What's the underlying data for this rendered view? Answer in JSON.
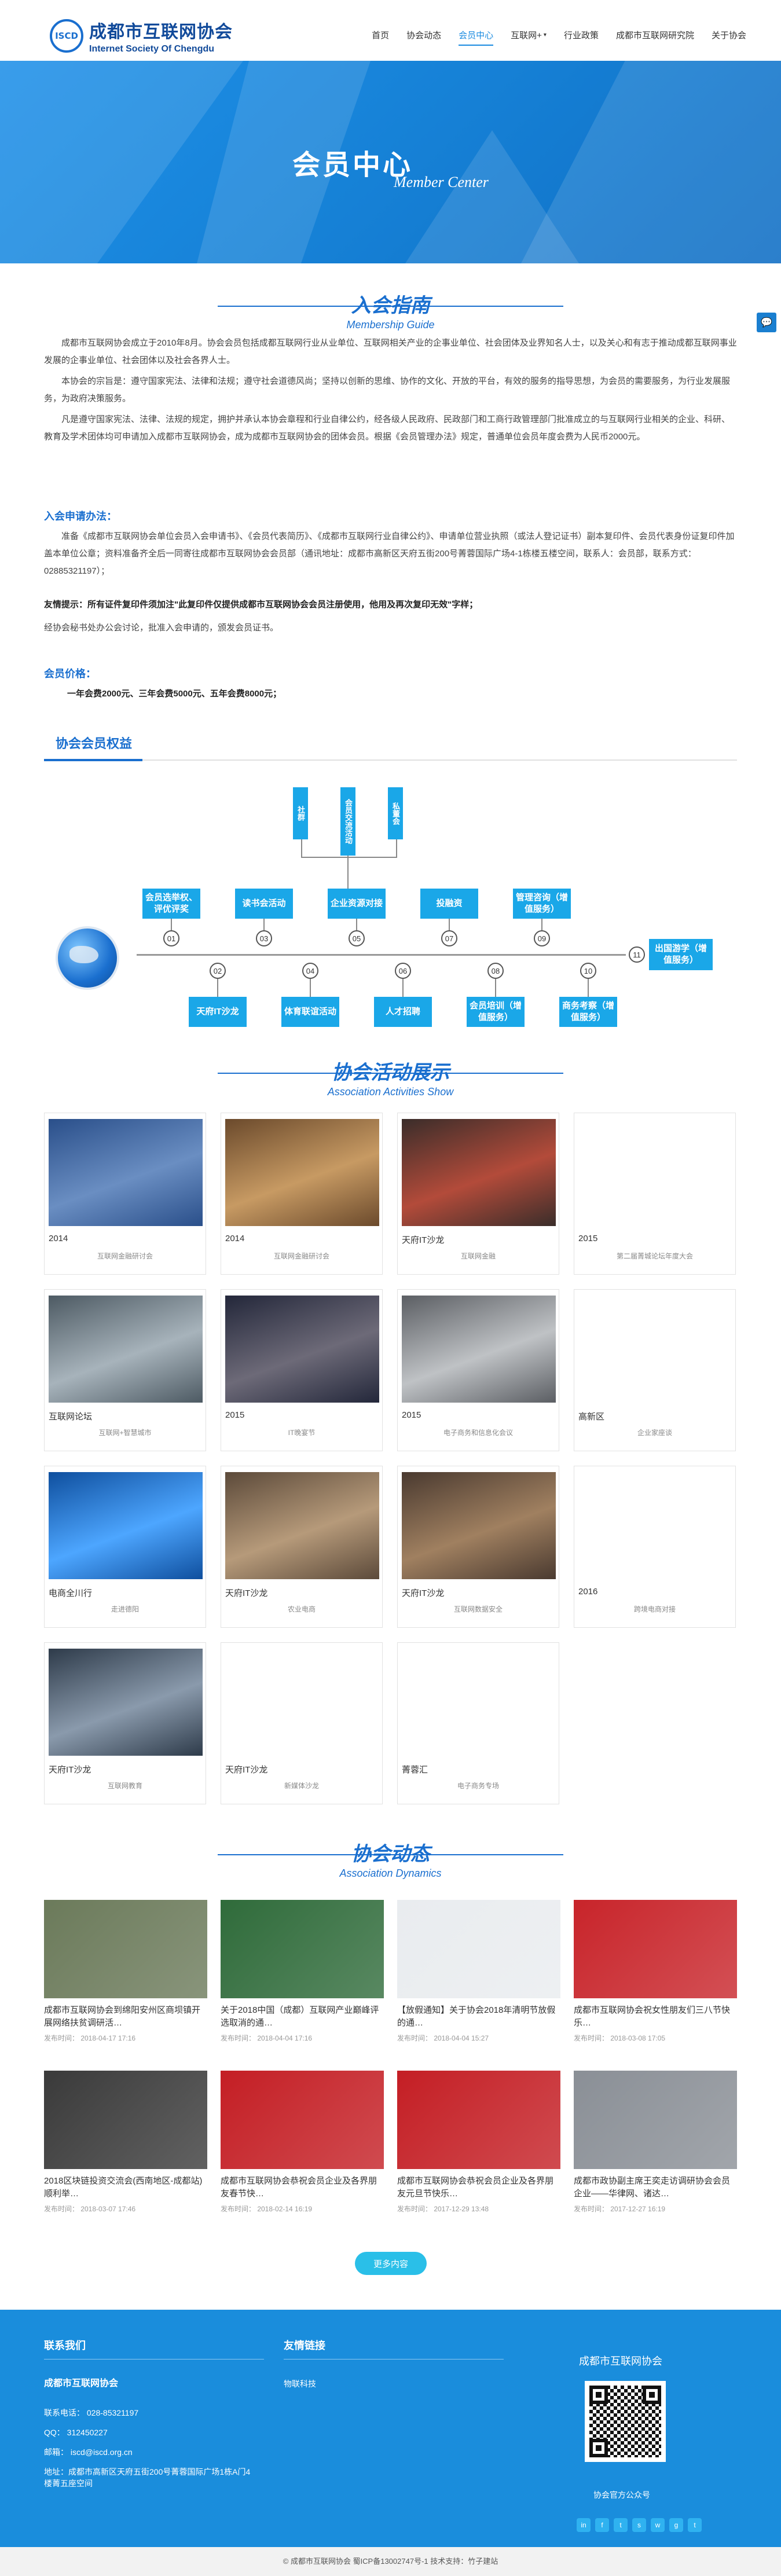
{
  "header": {
    "logo_badge": "ISCD",
    "logo_cn": "成都市互联网协会",
    "logo_en": "Internet Society Of Chengdu",
    "nav": [
      {
        "label": "首页",
        "active": false,
        "arrow": false
      },
      {
        "label": "协会动态",
        "active": false,
        "arrow": false
      },
      {
        "label": "会员中心",
        "active": true,
        "arrow": false
      },
      {
        "label": "互联网+",
        "active": false,
        "arrow": true
      },
      {
        "label": "行业政策",
        "active": false,
        "arrow": false
      },
      {
        "label": "成都市互联网研究院",
        "active": false,
        "arrow": false
      },
      {
        "label": "关于协会",
        "active": false,
        "arrow": false
      }
    ]
  },
  "banner": {
    "title": "会员中心",
    "subtitle": "Member Center"
  },
  "guide": {
    "title": "入会指南",
    "subtitle": "Membership Guide",
    "p1": "成都市互联网协会成立于2010年8月。协会会员包括成都互联网行业从业单位、互联网相关产业的企事业单位、社会团体及业界知名人士，以及关心和有志于推动成都互联网事业发展的企事业单位、社会团体以及社会各界人士。",
    "p2": "本协会的宗旨是：遵守国家宪法、法律和法规；遵守社会道德风尚；坚持以创新的思维、协作的文化、开放的平台，有效的服务的指导思想，为会员的需要服务，为行业发展服务，为政府决策服务。",
    "p3": "凡是遵守国家宪法、法律、法规的规定，拥护并承认本协会章程和行业自律公约，经各级人民政府、民政部门和工商行政管理部门批准成立的与互联网行业相关的企业、科研、教育及学术团体均可申请加入成都市互联网协会，成为成都市互联网协会的团体会员。根据《会员管理办法》规定，普通单位会员年度会费为人民币2000元。",
    "apply_title": "入会申请办法：",
    "apply_p": "准备《成都市互联网协会单位会员入会申请书》、《会员代表简历》、《成都市互联网行业自律公约》、申请单位营业执照（或法人登记证书）副本复印件、会员代表身份证复印件加盖本单位公章；资料准备齐全后一同寄往成都市互联网协会会员部（通讯地址：成都市高新区天府五街200号菁蓉国际广场4-1栋楼五楼空间，联系人：会员部，联系方式：02885321197）；",
    "warm_tip": "友情提示：所有证件复印件须加注\"此复印件仅提供成都市互联网协会会员注册使用，他用及再次复印无效\"字样；",
    "review": "经协会秘书处办公会讨论，批准入会申请的，颁发会员证书。",
    "fee_title": "会员价格：",
    "fee_text": "一年会费2000元、三年会费5000元、五年会费8000元；"
  },
  "structure": {
    "title": "协会会员权益",
    "vertical_boxes": [
      "社群",
      "会员交流活动",
      "私董会"
    ],
    "top_boxes": [
      "会员选举权、评优评奖",
      "读书会活动",
      "企业资源对接",
      "投融资",
      "管理咨询（增值服务）"
    ],
    "bottom_boxes": [
      "天府IT沙龙",
      "体育联谊活动",
      "人才招聘",
      "会员培训（增值服务）",
      "商务考察（增值服务）"
    ],
    "end_box": "出国游学（增值服务）",
    "nodes": [
      "01",
      "02",
      "03",
      "04",
      "05",
      "06",
      "07",
      "08",
      "09",
      "10",
      "11"
    ]
  },
  "activities": {
    "title": "协会活动展示",
    "subtitle": "Association Activities Show",
    "cards": [
      {
        "caption": "2014",
        "sub": "互联网金融研讨会"
      },
      {
        "caption": "2014",
        "sub": "互联网金融研讨会"
      },
      {
        "caption": "天府IT沙龙",
        "sub": "互联网金融"
      },
      {
        "caption": "2015",
        "sub": "第二届菁城论坛年度大会"
      },
      {
        "caption": "互联网论坛",
        "sub": "互联网+智慧城市"
      },
      {
        "caption": "2015",
        "sub": "IT晚宴节"
      },
      {
        "caption": "2015",
        "sub": "电子商务和信息化会议"
      },
      {
        "caption": "高新区",
        "sub": "企业家座谈"
      },
      {
        "caption": "电商全川行",
        "sub": "走进德阳"
      },
      {
        "caption": "天府IT沙龙",
        "sub": "农业电商"
      },
      {
        "caption": "天府IT沙龙",
        "sub": "互联网数据安全"
      },
      {
        "caption": "2016",
        "sub": "跨境电商对接"
      },
      {
        "caption": "天府IT沙龙",
        "sub": "互联网教育"
      },
      {
        "caption": "天府IT沙龙",
        "sub": "新媒体沙龙"
      },
      {
        "caption": "菁蓉汇",
        "sub": "电子商务专场"
      }
    ]
  },
  "news": {
    "title": "协会动态",
    "subtitle": "Association Dynamics",
    "items": [
      {
        "title": "成都市互联网协会到绵阳安州区商坝镇开展网络扶贫调研活…",
        "date": "发布时间： 2018-04-17 17:16"
      },
      {
        "title": "关于2018中国（成都）互联网产业巅峰评选取消的通…",
        "date": "发布时间： 2018-04-04 17:16"
      },
      {
        "title": "【放假通知】关于协会2018年清明节放假的通…",
        "date": "发布时间： 2018-04-04 15:27"
      },
      {
        "title": "成都市互联网协会祝女性朋友们三八节快乐…",
        "date": "发布时间： 2018-03-08 17:05"
      },
      {
        "title": "2018区块链投资交流会(西南地区-成都站)顺利举…",
        "date": "发布时间： 2018-03-07 17:46"
      },
      {
        "title": "成都市互联网协会恭祝会员企业及各界朋友春节快…",
        "date": "发布时间： 2018-02-14 16:19"
      },
      {
        "title": "成都市互联网协会恭祝会员企业及各界朋友元旦节快乐…",
        "date": "发布时间： 2017-12-29 13:48"
      },
      {
        "title": "成都市政协副主席王奕走访调研协会会员企业——华律网、诸达…",
        "date": "发布时间： 2017-12-27 16:19"
      }
    ],
    "more": "更多内容"
  },
  "footer": {
    "contact_title": "联系我们",
    "org": "成都市互联网协会",
    "phone": "联系电话：  028-85321197",
    "qq": "QQ：  312450227",
    "email": "邮箱：  iscd@iscd.org.cn",
    "address": "地址：成都市高新区天府五街200号菁蓉国际广场1栋A门4楼菁五座空间",
    "links_title": "友情链接",
    "link1": "物联科技",
    "brand": "成都市互联网协会",
    "qr_caption": "协会官方公众号",
    "social": [
      "in",
      "f",
      "t",
      "s",
      "w",
      "g",
      "t"
    ]
  },
  "copyright": "© 成都市互联网协会     蜀ICP备13002747号-1     技术支持：竹子建站"
}
